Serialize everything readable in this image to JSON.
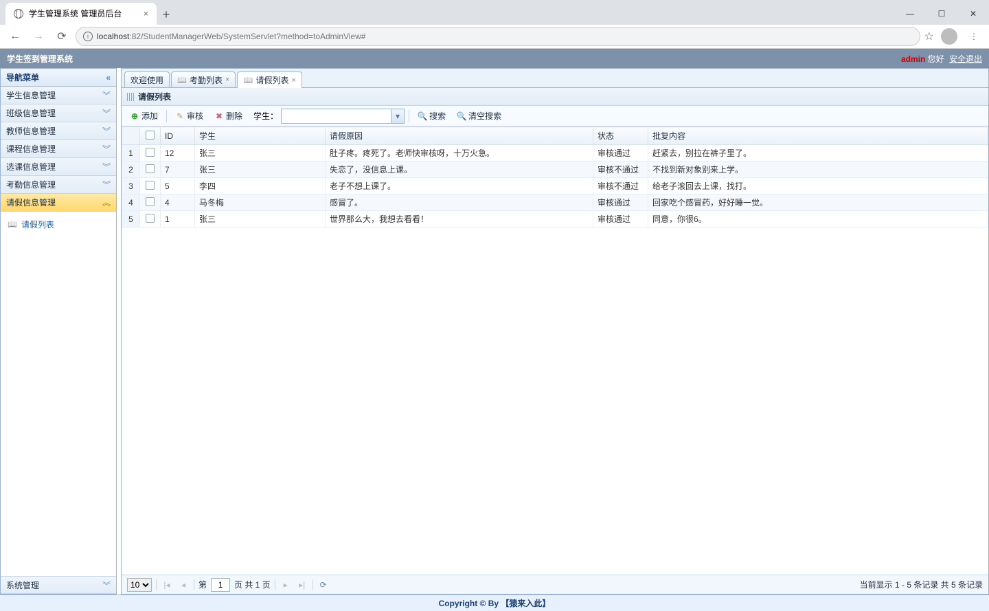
{
  "browser": {
    "tab_title": "学生管理系统 管理员后台",
    "url_prefix": "localhost",
    "url_port": ":82",
    "url_path": "/StudentManagerWeb/SystemServlet?method=toAdminView#"
  },
  "header": {
    "title": "学生签到管理系统",
    "username": "admin",
    "greeting": "您好",
    "logout": "安全退出"
  },
  "sidebar": {
    "title": "导航菜单",
    "items": [
      {
        "label": "学生信息管理",
        "active": false
      },
      {
        "label": "班级信息管理",
        "active": false
      },
      {
        "label": "教师信息管理",
        "active": false
      },
      {
        "label": "课程信息管理",
        "active": false
      },
      {
        "label": "选课信息管理",
        "active": false
      },
      {
        "label": "考勤信息管理",
        "active": false
      },
      {
        "label": "请假信息管理",
        "active": true
      }
    ],
    "tree_node": "请假列表",
    "bottom": "系统管理"
  },
  "tabs": [
    {
      "label": "欢迎使用",
      "icon": false,
      "closable": false,
      "active": false
    },
    {
      "label": "考勤列表",
      "icon": true,
      "closable": true,
      "active": false
    },
    {
      "label": "请假列表",
      "icon": true,
      "closable": true,
      "active": true
    }
  ],
  "panel": {
    "title": "请假列表"
  },
  "toolbar": {
    "add": "添加",
    "audit": "审核",
    "delete": "删除",
    "student_label": "学生：",
    "search": "搜索",
    "clear": "清空搜索"
  },
  "columns": [
    "ID",
    "学生",
    "请假原因",
    "状态",
    "批复内容"
  ],
  "rows": [
    {
      "n": "1",
      "id": "12",
      "student": "张三",
      "reason": "肚子疼。疼死了。老师快审核呀，十万火急。",
      "status": "审核通过",
      "reply": "赶紧去，别拉在裤子里了。"
    },
    {
      "n": "2",
      "id": "7",
      "student": "张三",
      "reason": "失恋了，没信息上课。",
      "status": "审核不通过",
      "reply": "不找到新对象别来上学。"
    },
    {
      "n": "3",
      "id": "5",
      "student": "李四",
      "reason": "老子不想上课了。",
      "status": "审核不通过",
      "reply": "给老子滚回去上课，找打。"
    },
    {
      "n": "4",
      "id": "4",
      "student": "马冬梅",
      "reason": "感冒了。",
      "status": "审核通过",
      "reply": "回家吃个感冒药，好好睡一觉。"
    },
    {
      "n": "5",
      "id": "1",
      "student": "张三",
      "reason": "世界那么大，我想去看看！",
      "status": "审核通过",
      "reply": "同意，你很6。"
    }
  ],
  "pager": {
    "page_size": "10",
    "page_label_pre": "第",
    "page_value": "1",
    "page_label_post": "页 共 1 页",
    "info": "当前显示 1 - 5 条记录 共 5 条记录"
  },
  "footer": "Copyright © By 【猿来入此】"
}
